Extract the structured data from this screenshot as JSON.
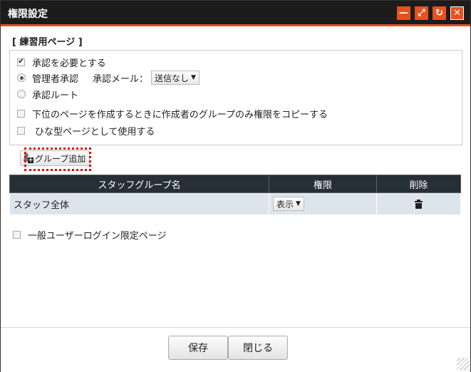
{
  "window": {
    "title": "権限設定",
    "controls": [
      {
        "name": "minimize-icon",
        "glyph": "—"
      },
      {
        "name": "maximize-icon",
        "glyph": "⤢"
      },
      {
        "name": "refresh-icon",
        "glyph": "↻"
      },
      {
        "name": "close-icon",
        "glyph": "✕"
      }
    ]
  },
  "page_section": {
    "title": "[ 練習用ページ ]",
    "require_approval": {
      "label": "承認を必要とする",
      "checked": true
    },
    "admin_approval": {
      "label": "管理者承認",
      "selected": true
    },
    "approval_mail": {
      "label": "承認メール：",
      "value": "送信なし"
    },
    "approval_route": {
      "label": "承認ルート",
      "selected": false
    },
    "copy_creator_group": {
      "label": "下位のページを作成するときに作成者のグループのみ権限をコピーする",
      "checked": false
    },
    "use_as_template": {
      "label": "ひな型ページとして使用する",
      "checked": false
    }
  },
  "add_group_button": {
    "label": "グループ追加"
  },
  "table": {
    "headers": [
      "スタッフグループ名",
      "権限",
      "削除"
    ],
    "rows": [
      {
        "group": "スタッフ全体",
        "permission": "表示"
      }
    ]
  },
  "general_user_login": {
    "label": "一般ユーザーログイン限定ページ",
    "checked": false
  },
  "footer": {
    "save_label": "保存",
    "close_label": "閉じる"
  },
  "colors": {
    "accent": "#e8511c",
    "titlebar": "#1c1c1c",
    "table_header": "#262e36",
    "table_row": "#dde5ec",
    "highlight_outline": "#e00000"
  }
}
